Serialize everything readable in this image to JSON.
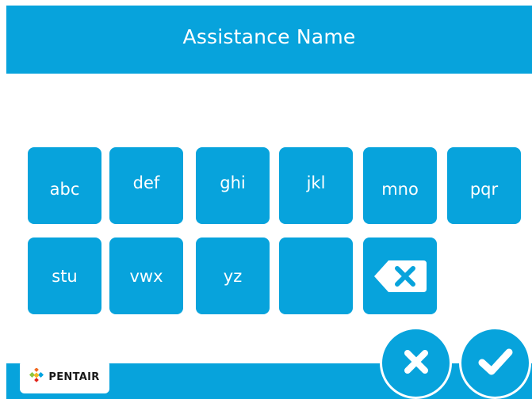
{
  "header": {
    "title": "Assistance Name"
  },
  "keypad": {
    "row1": [
      "abc",
      "def",
      "ghi",
      "jkl",
      "mno",
      "pqr"
    ],
    "row2": [
      "stu",
      "vwx",
      "yz",
      ""
    ]
  },
  "icons": {
    "backspace": "backspace-icon",
    "cancel": "close-icon",
    "confirm": "checkmark-icon",
    "logo": "pentair-logo-icon"
  },
  "footer": {
    "logo_text": "PENTAIR"
  },
  "colors": {
    "accent": "#07a3dc",
    "background": "#ffffff",
    "text_on_accent": "#ffffff"
  }
}
